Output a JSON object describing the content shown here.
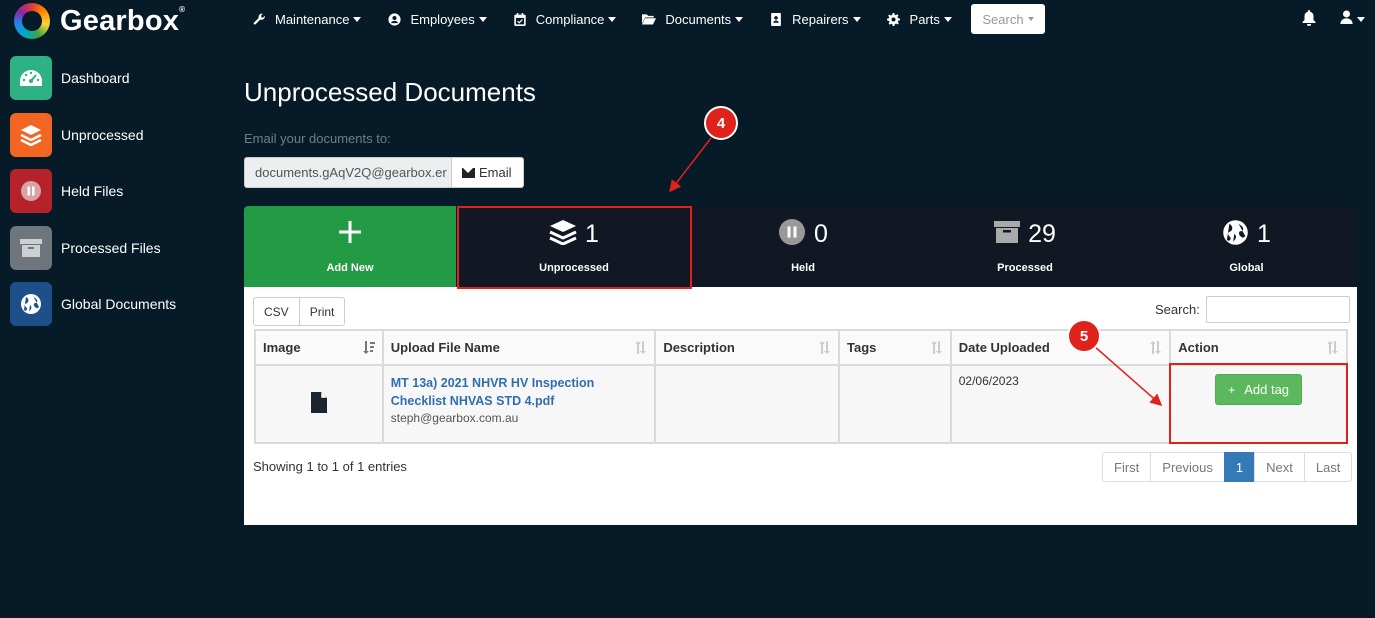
{
  "brand": {
    "name": "Gearbox",
    "mark": "®"
  },
  "nav": {
    "items": [
      {
        "label": "Maintenance",
        "icon": "wrench-icon"
      },
      {
        "label": "Employees",
        "icon": "user-circle-icon"
      },
      {
        "label": "Compliance",
        "icon": "calendar-icon"
      },
      {
        "label": "Documents",
        "icon": "folder-open-icon"
      },
      {
        "label": "Repairers",
        "icon": "address-book-icon"
      },
      {
        "label": "Parts",
        "icon": "gear-icon"
      }
    ],
    "search_label": "Search"
  },
  "sidebar": {
    "items": [
      {
        "label": "Dashboard",
        "icon": "dashboard-icon",
        "color": "#2eb183"
      },
      {
        "label": "Unprocessed",
        "icon": "layers-icon",
        "color": "#f26522"
      },
      {
        "label": "Held Files",
        "icon": "pause-icon",
        "color": "#b5222a"
      },
      {
        "label": "Processed Files",
        "icon": "archive-icon",
        "color": "#6e757c"
      },
      {
        "label": "Global Documents",
        "icon": "globe-icon",
        "color": "#1d4f8a"
      }
    ]
  },
  "page": {
    "title": "Unprocessed Documents",
    "email_label": "Email your documents to:",
    "email_value": "documents.gAqV2Q@gearbox.er",
    "email_button": "Email"
  },
  "tiles": {
    "add": {
      "label": "Add New"
    },
    "unprocessed": {
      "label": "Unprocessed",
      "count": "1"
    },
    "held": {
      "label": "Held",
      "count": "0"
    },
    "processed": {
      "label": "Processed",
      "count": "29"
    },
    "global": {
      "label": "Global",
      "count": "1"
    }
  },
  "table": {
    "buttons": {
      "csv": "CSV",
      "print": "Print"
    },
    "search_label": "Search:",
    "columns": [
      "Image",
      "Upload File Name",
      "Description",
      "Tags",
      "Date Uploaded",
      "Action"
    ],
    "rows": [
      {
        "file_name": "MT 13a) 2021 NHVR HV Inspection Checklist NHVAS STD 4.pdf",
        "uploader": "steph@gearbox.com.au",
        "description": "",
        "tags": "",
        "date": "02/06/2023",
        "action": "Add tag"
      }
    ],
    "info": "Showing 1 to 1 of 1 entries",
    "pagination": {
      "first": "First",
      "previous": "Previous",
      "current": "1",
      "next": "Next",
      "last": "Last"
    }
  },
  "annotations": [
    {
      "number": "4",
      "target": "unprocessed-tile"
    },
    {
      "number": "5",
      "target": "add-tag-button"
    }
  ],
  "colors": {
    "background": "#061a27",
    "add_tile": "#239a44",
    "annotation": "#e0221d",
    "link": "#2f6fb0"
  }
}
